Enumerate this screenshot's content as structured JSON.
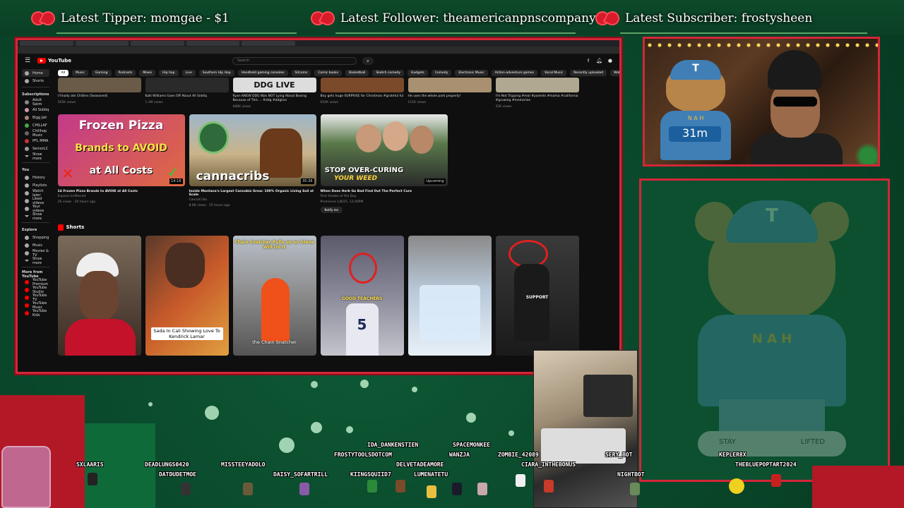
{
  "banner": {
    "tipper": "Latest Tipper: momgae - $1",
    "follower": "Latest Follower: theamericanpnscompany",
    "subscriber": "Latest Subscriber: frostysheen"
  },
  "youtube": {
    "logo": "YouTube",
    "search_placeholder": "Search",
    "chips": [
      "All",
      "Music",
      "Gaming",
      "Podcasts",
      "Mixes",
      "Hip hop",
      "Live",
      "Southern Hip Hop",
      "Handheld gaming consoles",
      "Sitcoms",
      "Comic books",
      "Basketball",
      "Sketch comedy",
      "Gadgets",
      "Comedy",
      "Electronic Music",
      "Action-adventure games",
      "Vocal Music",
      "Recently uploaded",
      "Watched"
    ],
    "sidebar": {
      "top": [
        {
          "label": "Home",
          "icon": "home-icon"
        },
        {
          "label": "Shorts",
          "icon": "shorts-icon"
        }
      ],
      "subscriptions_title": "Subscriptions",
      "subscriptions": [
        "Adult Swim",
        "All Siddiq",
        "Bigg Jah",
        "CHILLAF",
        "Chillhop Music",
        "PFL MMA",
        "SeniorLC"
      ],
      "show_more": "Show more",
      "you_title": "You",
      "you_items": [
        "History",
        "Playlists",
        "Watch later",
        "Liked videos",
        "Your videos"
      ],
      "explore_title": "Explore",
      "explore_items": [
        "Shopping",
        "Music",
        "Movies & TV"
      ],
      "more_title": "More from YouTube",
      "more_items": [
        "YouTube Premium",
        "YouTube Studio",
        "YouTube TV",
        "YouTube Music",
        "YouTube Kids"
      ]
    },
    "row1": [
      {
        "title": "I Finally ate Chitlins (Seasoned)",
        "meta": "565K views"
      },
      {
        "title": "Katt Williams Goes Off About All Siddiq",
        "meta": "1.3M views"
      },
      {
        "title": "Ryan KNEW DDG Was NOT Lying About Boxing Because of This ... #ddg #ddglive",
        "meta": "686K views"
      },
      {
        "title": "Boy gets huge SURPRISE for Christmas #grateful ful",
        "meta": "650K views"
      },
      {
        "title": "He uses the whole park properly!",
        "meta": "111K views"
      },
      {
        "title": "I'm Not Tripping #real #parents #mama #california #growing #memories",
        "meta": "32K views"
      }
    ],
    "row1_thumb_text": "DDG LIVE",
    "row2": [
      {
        "thumb_lines": [
          "Frozen Pizza",
          "Brands to AVOID",
          "at All Costs"
        ],
        "duration": "14:16",
        "title": "14 Frozen Pizza Brands to AVOID at All Costs",
        "channel": "Expose Unfiltered",
        "meta": "26 views · 20 hours ago"
      },
      {
        "thumb_lines": [
          "cannacribs"
        ],
        "duration": "35:36",
        "title": "Inside Montana's Largest Cannabis Grow: 100% Organic Living Soil at Scale",
        "channel": "CannaCribs",
        "meta": "8.9K views · 15 hours ago"
      },
      {
        "thumb_lines": [
          "STOP OVER-CURING",
          "YOUR WEED"
        ],
        "duration": "Upcoming",
        "title": "When Does Herb Go Bad Find Out The Perfect Cure",
        "channel": "First Smoke of the Day",
        "meta": "Premieres 1/8/25, 12:00PM",
        "button": "Notify me"
      }
    ],
    "shorts_title": "Shorts",
    "shorts": [
      {
        "overlay": "",
        "caption": ""
      },
      {
        "overlay": "",
        "caption": "Sada In Cali Showing Love To Kendrick Lamar"
      },
      {
        "overlay": "Chain Snatcher Pulls up on Steve Will Do It",
        "caption": "the Chain Snatcher"
      },
      {
        "overlay": "GOOD TEACHERS",
        "caption": ""
      },
      {
        "overlay": "",
        "caption": ""
      },
      {
        "overlay": "SUPPORT",
        "caption": ""
      }
    ]
  },
  "webcam": {
    "timer": "31m",
    "bear_cap_letter": "T",
    "bear_shirt": "N A H"
  },
  "bear_panel": {
    "cap_letter": "T",
    "shirt_text": "N A H",
    "shoe_text_left": "STAY",
    "shoe_text_right": "LIFTED"
  },
  "chatters": [
    {
      "name": "SXLAARIS"
    },
    {
      "name": "DEADLUNGS0420"
    },
    {
      "name": "DATDUDETMOE"
    },
    {
      "name": "MISSTEEYADOLO"
    },
    {
      "name": "DAISY_SOFARTRILL"
    },
    {
      "name": "IDA_DANKENSTIEN"
    },
    {
      "name": "FROSTYTOOLSDOTCOM"
    },
    {
      "name": "KIINGSQUIID7"
    },
    {
      "name": "DELVETADEAMORE"
    },
    {
      "name": "LUMENATETU"
    },
    {
      "name": "SPACEMONKEE"
    },
    {
      "name": "WANZJA"
    },
    {
      "name": "ZOMBIE_42089"
    },
    {
      "name": "CIARA_INTHEBONUS"
    },
    {
      "name": "SERY_BOT"
    },
    {
      "name": "NIGHTBOT"
    },
    {
      "name": "KEPLER8X"
    },
    {
      "name": "THEBLUEPOPTART2024"
    }
  ],
  "colors": {
    "background": "#0a4a2c",
    "frame_red": "#d42638",
    "youtube_red": "#ff0000"
  }
}
